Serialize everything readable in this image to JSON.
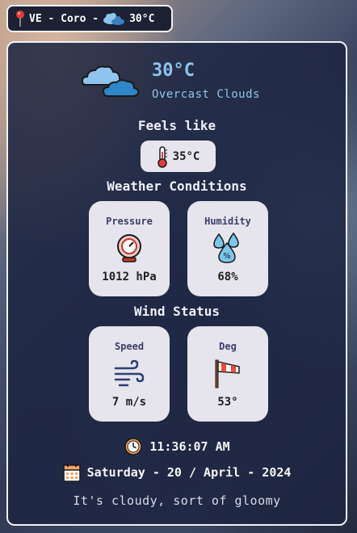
{
  "topbar": {
    "location": "VE - Coro -",
    "temperature": "30°C"
  },
  "current": {
    "temperature": "30°C",
    "description": "Overcast Clouds"
  },
  "feels_like": {
    "heading": "Feels like",
    "value": "35°C"
  },
  "conditions": {
    "heading": "Weather Conditions",
    "pressure": {
      "label": "Pressure",
      "value": "1012 hPa"
    },
    "humidity": {
      "label": "Humidity",
      "value": "68%"
    }
  },
  "wind": {
    "heading": "Wind Status",
    "speed": {
      "label": "Speed",
      "value": "7 m/s"
    },
    "deg": {
      "label": "Deg",
      "value": "53°"
    }
  },
  "time": "11:36:07 AM",
  "date": "Saturday - 20 / April - 2024",
  "message": "It's  cloudy, sort of gloomy",
  "colors": {
    "accent": "#8ec4ee",
    "card_bg": "#e6e4ec",
    "panel_bg": "#1c2440"
  },
  "icons": [
    "location-pin-icon",
    "cloud-icon",
    "thermometer-icon",
    "pressure-gauge-icon",
    "humidity-drops-icon",
    "wind-icon",
    "windsock-icon",
    "clock-icon",
    "calendar-icon"
  ]
}
